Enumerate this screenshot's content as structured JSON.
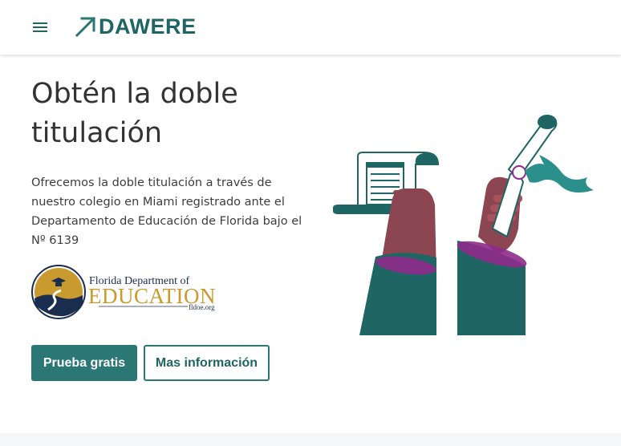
{
  "header": {
    "brand": "DAWERE",
    "menu_icon": "hamburger-menu-icon",
    "colors": {
      "brand": "#1f6563"
    }
  },
  "hero": {
    "title": "Obtén la doble titulación",
    "description": "Ofrecemos la doble titulación a través de nuestro colegio en Miami registrado ante el Departamento de Educación de Florida bajo el Nº 6139",
    "partner_logo": {
      "line1": "Florida Department of",
      "line2": "EDUCATION",
      "url_text": "fldoe.org"
    },
    "primary_button": "Prueba gratis",
    "secondary_button": "Mas información"
  },
  "theme": {
    "accent": "#2b7776",
    "text": "#333333",
    "illustration_skin": "#8b4651",
    "illustration_sleeve": "#1f6563",
    "illustration_cuff": "#8e2a8a"
  }
}
